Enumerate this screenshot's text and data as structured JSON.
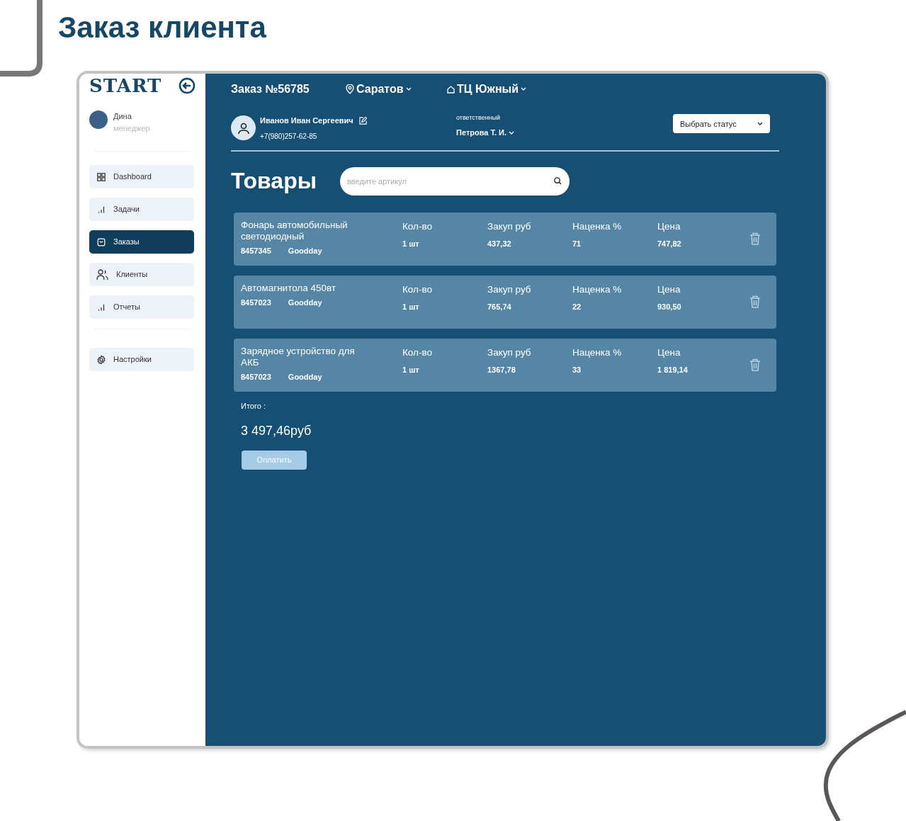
{
  "page_title": "Заказ клиента",
  "sidebar": {
    "logo": "START",
    "user": {
      "name": "Дина",
      "role": "менеджер"
    },
    "items": [
      {
        "label": "Dashboard",
        "selected": false
      },
      {
        "label": "Задачи",
        "selected": false
      },
      {
        "label": "Заказы",
        "selected": true
      },
      {
        "label": "Клиенты",
        "selected": false
      },
      {
        "label": "Отчеты",
        "selected": false
      }
    ],
    "settings": {
      "label": "Настройки",
      "selected": false
    }
  },
  "header": {
    "order": "Заказ №56785",
    "city": "Саратов",
    "store": "ТЦ Южный"
  },
  "customer": {
    "name": "Иванов Иван Сергеевич",
    "phone": "+7(980)257-62-85",
    "responsible_label": "ответственный",
    "responsible": "Петрова Т. И.",
    "status_placeholder": "Выбрать статус"
  },
  "products_title": "Товары",
  "search": {
    "placeholder": "введите артикул"
  },
  "products": [
    {
      "name": "Фонарь автомобильный светодиодный",
      "article": "8457345",
      "brand": "Goodday",
      "fields": [
        {
          "label": "Кол-во",
          "value": "1 шт"
        },
        {
          "label": "Закуп руб",
          "value": "437,32"
        },
        {
          "label": "Наценка %",
          "value": "71"
        },
        {
          "label": "Цена",
          "value": "747,82"
        }
      ]
    },
    {
      "name": "Автомагнитола  450вт",
      "article": "8457023",
      "brand": "Goodday",
      "fields": [
        {
          "label": "Кол-во",
          "value": "1 шт"
        },
        {
          "label": "Закуп руб",
          "value": "765,74"
        },
        {
          "label": "Наценка %",
          "value": "22"
        },
        {
          "label": "Цена",
          "value": "930,50"
        }
      ]
    },
    {
      "name": "Зарядное устройство для АКБ",
      "article": "8457023",
      "brand": "Goodday",
      "fields": [
        {
          "label": "Кол-во",
          "value": "1 шт"
        },
        {
          "label": "Закуп руб",
          "value": "1367,78"
        },
        {
          "label": "Наценка %",
          "value": "33"
        },
        {
          "label": "Цена",
          "value": "1 819,14"
        }
      ]
    }
  ],
  "total": {
    "label": "Итого :",
    "value": "3 497,46руб"
  },
  "pay_button": {
    "label": "Оплатить",
    "disabled": true
  }
}
